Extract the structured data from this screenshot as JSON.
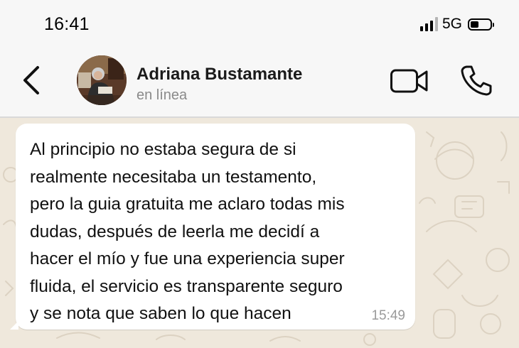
{
  "status_bar": {
    "time": "16:41",
    "network": "5G"
  },
  "header": {
    "contact_name": "Adriana Bustamante",
    "contact_status": "en línea",
    "icons": [
      "back-chevron-icon",
      "avatar-photo",
      "video-camera-icon",
      "phone-icon"
    ]
  },
  "message": {
    "text": "Al principio no estaba segura de si\nrealmente necesitaba un testamento,\npero la guia gratuita me aclaro todas mis\ndudas, después de leerla me decidí a\nhacer el mío y fue una experiencia super\nfluida, el servicio es transparente seguro\ny se nota que saben lo que hacen",
    "time": "15:49"
  },
  "colors": {
    "header_bg": "#f7f7f7",
    "chat_bg": "#efe8dc",
    "bubble_bg": "#ffffff",
    "secondary_text": "#8a8a8a"
  }
}
